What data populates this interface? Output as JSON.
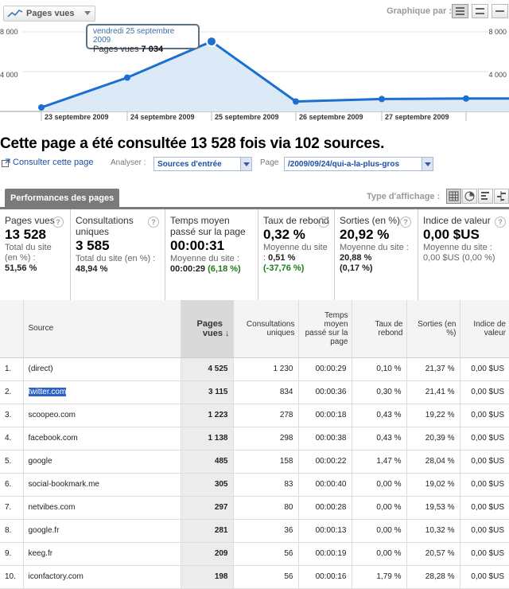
{
  "toolbar": {
    "metric_select": "Pages vues",
    "graph_label": "Graphique par :"
  },
  "chart_data": {
    "type": "area",
    "title": "",
    "xlabel": "",
    "ylabel": "",
    "y_ticks": [
      "8 000",
      "4 000"
    ],
    "ylim": [
      0,
      8000
    ],
    "x_labels": [
      "23 septembre 2009",
      "24 septembre 2009",
      "25 septembre 2009",
      "26 septembre 2009",
      "27 septembre 2009"
    ],
    "series": [
      {
        "values": [
          400,
          3400,
          7034,
          1000,
          1250,
          1300,
          1300
        ]
      }
    ],
    "tooltip": {
      "date": "vendredi 25 septembre 2009",
      "label": "Pages vues",
      "value": "7 034"
    },
    "grid": true,
    "colors": {
      "line": "#1a6fd1",
      "fill": "#dbeaf6"
    }
  },
  "heading": "Cette page a été consultée 13 528 fois via 102 sources.",
  "controls": {
    "consult_link": "Consulter cette page",
    "analyse_label": "Analyser :",
    "analyse_value": "Sources d'entrée",
    "page_label": "Page",
    "page_value": "/2009/09/24/qui-a-la-plus-gros"
  },
  "tab": {
    "label": "Performances des pages",
    "view_label": "Type d'affichage :"
  },
  "summary": [
    {
      "title": "Pages vues",
      "value": "13 528",
      "sub1": "Total du site (en %) :",
      "sub2": "51,56 %",
      "sub3": ""
    },
    {
      "title": "Consultations uniques",
      "value": "3 585",
      "sub1": "Total du site (en %) :",
      "sub2": "48,94 %",
      "sub3": ""
    },
    {
      "title": "Temps moyen passé sur la page",
      "value": "00:00:31",
      "sub1": "Moyenne du site :",
      "sub2": "00:00:29",
      "sub3": "(6,18 %)"
    },
    {
      "title": "Taux de rebond",
      "value": "0,32 %",
      "sub1": "Moyenne du site :",
      "sub2": "0,51 %",
      "sub3": "(-37,76 %)"
    },
    {
      "title": "Sorties (en %)",
      "value": "20,92 %",
      "sub1": "Moyenne du site :",
      "sub2": "20,88 %",
      "sub3": "(0,17 %)"
    },
    {
      "title": "Indice de valeur",
      "value": "0,00 $US",
      "sub1": "Moyenne du site :",
      "sub2": "0,00 $US",
      "sub3": "(0,00 %)"
    }
  ],
  "table": {
    "headers": [
      "Source",
      "Pages vues",
      "Consultations uniques",
      "Temps moyen passé sur la page",
      "Taux de rebond",
      "Sorties (en %)",
      "Indice de valeur"
    ],
    "rows": [
      [
        "1.",
        "(direct)",
        "4 525",
        "1 230",
        "00:00:29",
        "0,10 %",
        "21,37 %",
        "0,00 $US"
      ],
      [
        "2.",
        "twitter.com",
        "3 115",
        "834",
        "00:00:36",
        "0,30 %",
        "21,41 %",
        "0,00 $US"
      ],
      [
        "3.",
        "scoopeo.com",
        "1 223",
        "278",
        "00:00:18",
        "0,43 %",
        "19,22 %",
        "0,00 $US"
      ],
      [
        "4.",
        "facebook.com",
        "1 138",
        "298",
        "00:00:38",
        "0,43 %",
        "20,39 %",
        "0,00 $US"
      ],
      [
        "5.",
        "google",
        "485",
        "158",
        "00:00:22",
        "1,47 %",
        "28,04 %",
        "0,00 $US"
      ],
      [
        "6.",
        "social-bookmark.me",
        "305",
        "83",
        "00:00:40",
        "0,00 %",
        "19,02 %",
        "0,00 $US"
      ],
      [
        "7.",
        "netvibes.com",
        "297",
        "80",
        "00:00:28",
        "0,00 %",
        "19,53 %",
        "0,00 $US"
      ],
      [
        "8.",
        "google.fr",
        "281",
        "36",
        "00:00:13",
        "0,00 %",
        "10,32 %",
        "0,00 $US"
      ],
      [
        "9.",
        "keeg.fr",
        "209",
        "56",
        "00:00:19",
        "0,00 %",
        "20,57 %",
        "0,00 $US"
      ],
      [
        "10.",
        "iconfactory.com",
        "198",
        "56",
        "00:00:16",
        "1,79 %",
        "28,28 %",
        "0,00 $US"
      ]
    ]
  }
}
